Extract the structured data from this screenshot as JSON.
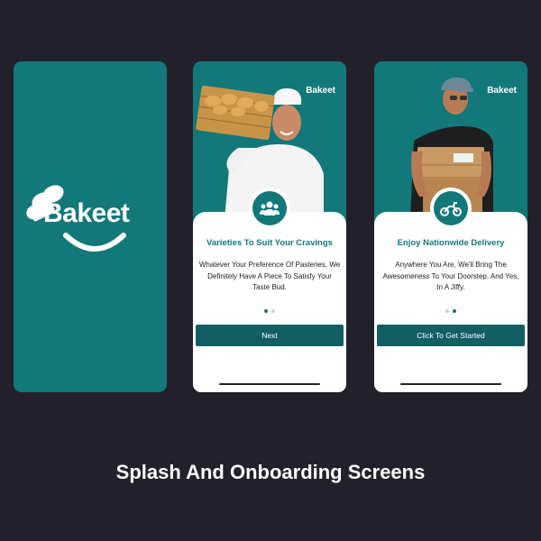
{
  "colors": {
    "background": "#22212b",
    "brand_teal": "#13787a",
    "button_teal": "#125f63",
    "dot_inactive": "#cfd2d3",
    "white": "#ffffff"
  },
  "splash": {
    "logo_text": "Bakeet",
    "icons": [
      "chef-hat-icon",
      "smile-icon"
    ]
  },
  "onboarding": [
    {
      "logo_text": "Bakeet",
      "hero_image": "baker-with-bread-basket",
      "icon": "people-group-icon",
      "title": "Varieties To Suit Your Cravings",
      "description": "Whatever Your Preference Of Pasteries, We Definitely Have A Piece To Satisfy Your Taste Bud.",
      "active_dot": 1,
      "button_label": "Next"
    },
    {
      "logo_text": "Bakeet",
      "hero_image": "delivery-man-with-boxes",
      "icon": "motorbike-icon",
      "title": "Enjoy Nationwide Delivery",
      "description": "Anywhere You Are, We'll Bring The Awesomeness To Your Doorstep. And Yes, In A Jiffy.",
      "active_dot": 2,
      "button_label": "Click To Get Started"
    }
  ],
  "caption": "Splash And Onboarding Screens"
}
